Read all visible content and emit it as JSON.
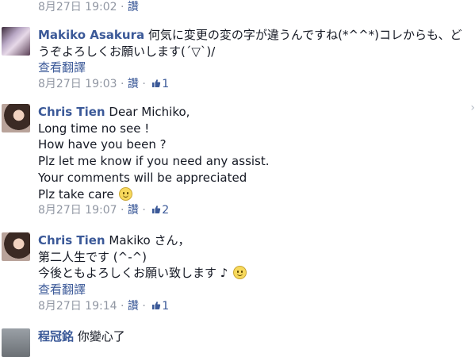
{
  "top_meta": {
    "timestamp": "8月27日 19:02",
    "dot": "·",
    "like_action": "讚"
  },
  "comments": [
    {
      "author": "Makiko Asakura",
      "lines": [
        "何気に変更の変の字が違うんですね(*^^*)コレからも、ど",
        "うぞよろしくお願いします(´▽`)/"
      ],
      "translate": "查看翻譯",
      "timestamp": "8月27日 19:03",
      "dot": "·",
      "like_action": "讚",
      "like_count": "1"
    },
    {
      "author": "Chris Tien",
      "lines": [
        "Dear Michiko,",
        "Long time no see !",
        "How have you been ?",
        "Plz let me know if you need any assist.",
        "Your comments will be appreciated",
        "Plz take care"
      ],
      "timestamp": "8月27日 19:07",
      "dot": "·",
      "like_action": "讚",
      "like_count": "2"
    },
    {
      "author": "Chris Tien",
      "lines": [
        "Makiko さん，",
        "第二人生です (^-^)",
        "今後ともよろしくお願い致します ♪"
      ],
      "translate": "查看翻譯",
      "timestamp": "8月27日 19:14",
      "dot": "·",
      "like_action": "讚",
      "like_count": "1"
    },
    {
      "author": "程冠銘",
      "lines": [
        "你變心了"
      ]
    }
  ],
  "icons": {
    "like": "thumbs-up-icon",
    "smile": "smiley-emoji-icon",
    "nav": "chevron-right-icon"
  },
  "colors": {
    "link": "#3b5998",
    "meta": "#9197a3",
    "text": "#141823"
  }
}
